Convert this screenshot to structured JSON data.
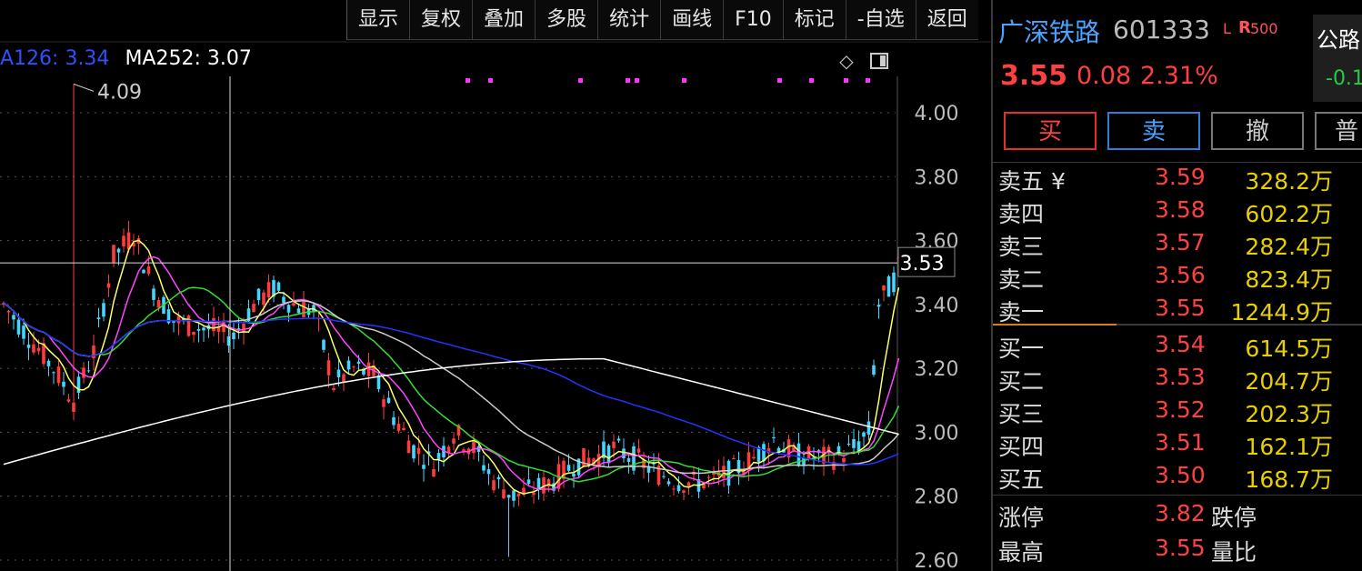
{
  "toolbar": {
    "items": [
      "显示",
      "复权",
      "叠加",
      "多股",
      "统计",
      "画线",
      "F10",
      "标记",
      "-自选",
      "返回"
    ]
  },
  "ma_legend": {
    "ma126": "A126: 3.34",
    "ma252": "MA252: 3.07",
    "ma126_color": "#1a33ff",
    "ma252_color": "#ffffff"
  },
  "chart": {
    "price_ticks": [
      "4.00",
      "3.80",
      "3.60",
      "3.40",
      "3.20",
      "3.00",
      "2.80",
      "2.60"
    ],
    "price_tick_values": [
      4.0,
      3.8,
      3.6,
      3.4,
      3.2,
      3.0,
      2.8,
      2.6
    ],
    "high_label": "4.09",
    "high_value": 4.09,
    "crosshair_label": "3.53",
    "crosshair_value": 3.53,
    "up_color": "#ff3b3b",
    "down_color": "#44d6ff"
  },
  "stock": {
    "name": "广深铁路",
    "code": "601333",
    "badge_l": "L",
    "badge_r": "R",
    "badge_500": "500",
    "price": "3.55",
    "change": "0.08",
    "change_pct": "2.31%"
  },
  "index": {
    "name": "公路",
    "change": "-0.1"
  },
  "trade_buttons": {
    "buy": "买",
    "sell": "卖",
    "cancel": "撤",
    "more": "普"
  },
  "order_book": {
    "asks": [
      {
        "label": "卖五 ¥",
        "price": "3.59",
        "volume": "328.2万"
      },
      {
        "label": "卖四",
        "price": "3.58",
        "volume": "602.2万"
      },
      {
        "label": "卖三",
        "price": "3.57",
        "volume": "282.4万"
      },
      {
        "label": "卖二",
        "price": "3.56",
        "volume": "823.4万"
      },
      {
        "label": "卖一",
        "price": "3.55",
        "volume": "1244.9万"
      }
    ],
    "bids": [
      {
        "label": "买一",
        "price": "3.54",
        "volume": "614.5万"
      },
      {
        "label": "买二",
        "price": "3.53",
        "volume": "204.7万"
      },
      {
        "label": "买三",
        "price": "3.52",
        "volume": "202.3万"
      },
      {
        "label": "买四",
        "price": "3.51",
        "volume": "162.1万"
      },
      {
        "label": "买五",
        "price": "3.50",
        "volume": "168.7万"
      }
    ]
  },
  "limits": {
    "limit_up_label": "涨停",
    "limit_up": "3.82",
    "limit_down_label": "跌停",
    "high_label": "最高",
    "high": "3.55",
    "volume_ratio_label": "量比"
  }
}
